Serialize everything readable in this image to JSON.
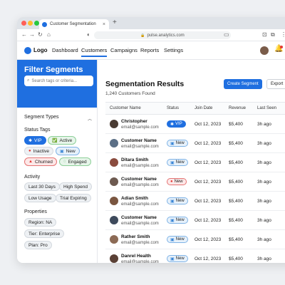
{
  "browser": {
    "tab_title": "Customer Segmentation",
    "tab_close": "×",
    "new_tab": "+",
    "url": "pulse.analytics.com",
    "traffic_lights": [
      "#ff5f57",
      "#febc2e",
      "#28c840"
    ]
  },
  "app": {
    "logo": "Logo",
    "nav": [
      "Dashboard",
      "Customers",
      "Campaigns",
      "Reports",
      "Settings"
    ],
    "active_nav": "Customers"
  },
  "sidebar": {
    "title": "Filter Segments",
    "search_placeholder": "Search tags or criteria...",
    "section_title": "Segment Types",
    "status_tags_title": "Status Tags",
    "status_tags": [
      {
        "label": "VIP",
        "icon": "star-icon",
        "color": "#1f6fe0"
      },
      {
        "label": "Active",
        "icon": "check-icon",
        "color": "#2e9e44"
      },
      {
        "label": "Inactive",
        "icon": "dot-icon",
        "color": "#e53935"
      },
      {
        "label": "New",
        "icon": "new-icon",
        "color": "#3a86d6"
      },
      {
        "label": "Churned",
        "icon": "warning-icon",
        "color": "#e53935"
      },
      {
        "label": "Engaged",
        "icon": "chat-icon",
        "color": "#2e9e44"
      }
    ],
    "activity_title": "Activity",
    "activity_tags": [
      "Last 30 Days",
      "High Spend",
      "Low Usage",
      "Trial Expiring"
    ],
    "properties_title": "Properties",
    "property_tags": [
      "Region: NA",
      "Tier: Enterprise",
      "Plan: Pro"
    ]
  },
  "main": {
    "title": "Segmentation Results",
    "subtitle": "1,240 Customers Found",
    "create_button": "Create Segment",
    "export_button": "Export",
    "columns": [
      "Customer Name",
      "Status",
      "Join Date",
      "Revenue",
      "Last Seen"
    ],
    "rows": [
      {
        "name": "Christopher",
        "email": "email@sample.com",
        "status": "VIP",
        "join": "Oct 12, 2023",
        "revenue": "$5,400",
        "last_seen": "3h ago"
      },
      {
        "name": "Customer Name",
        "email": "email@sample.com",
        "status": "New",
        "join": "Oct 12, 2023",
        "revenue": "$5,400",
        "last_seen": "3h ago"
      },
      {
        "name": "Ditara Smith",
        "email": "email@sample.com",
        "status": "New",
        "join": "Oct 12, 2023",
        "revenue": "$5,400",
        "last_seen": "3h ago"
      },
      {
        "name": "Customer Name",
        "email": "email@sample.com",
        "status": "New",
        "join": "Oct 12, 2023",
        "revenue": "$5,400",
        "last_seen": "3h ago"
      },
      {
        "name": "Adian Smith",
        "email": "email@sample.com",
        "status": "New",
        "join": "Oct 12, 2023",
        "revenue": "$5,400",
        "last_seen": "3h ago"
      },
      {
        "name": "Customer Name",
        "email": "email@sample.com",
        "status": "New",
        "join": "Oct 12, 2023",
        "revenue": "$5,400",
        "last_seen": "3h ago"
      },
      {
        "name": "Rather Smith",
        "email": "email@sample.com",
        "status": "New",
        "join": "Oct 12, 2023",
        "revenue": "$5,400",
        "last_seen": "3h ago"
      },
      {
        "name": "Danrel Health",
        "email": "email@sample.com",
        "status": "New",
        "join": "Oct 12, 2023",
        "revenue": "$5,400",
        "last_seen": "3h ago"
      }
    ]
  },
  "colors": {
    "accent": "#1f6fe0",
    "vip_badge": "#1f6fe0",
    "new_badge_bg": "#e6f1fb",
    "new_badge_border": "#7fb3e6",
    "new_badge_bg_alt": "#fde8e8",
    "new_badge_border_alt": "#e57373"
  }
}
